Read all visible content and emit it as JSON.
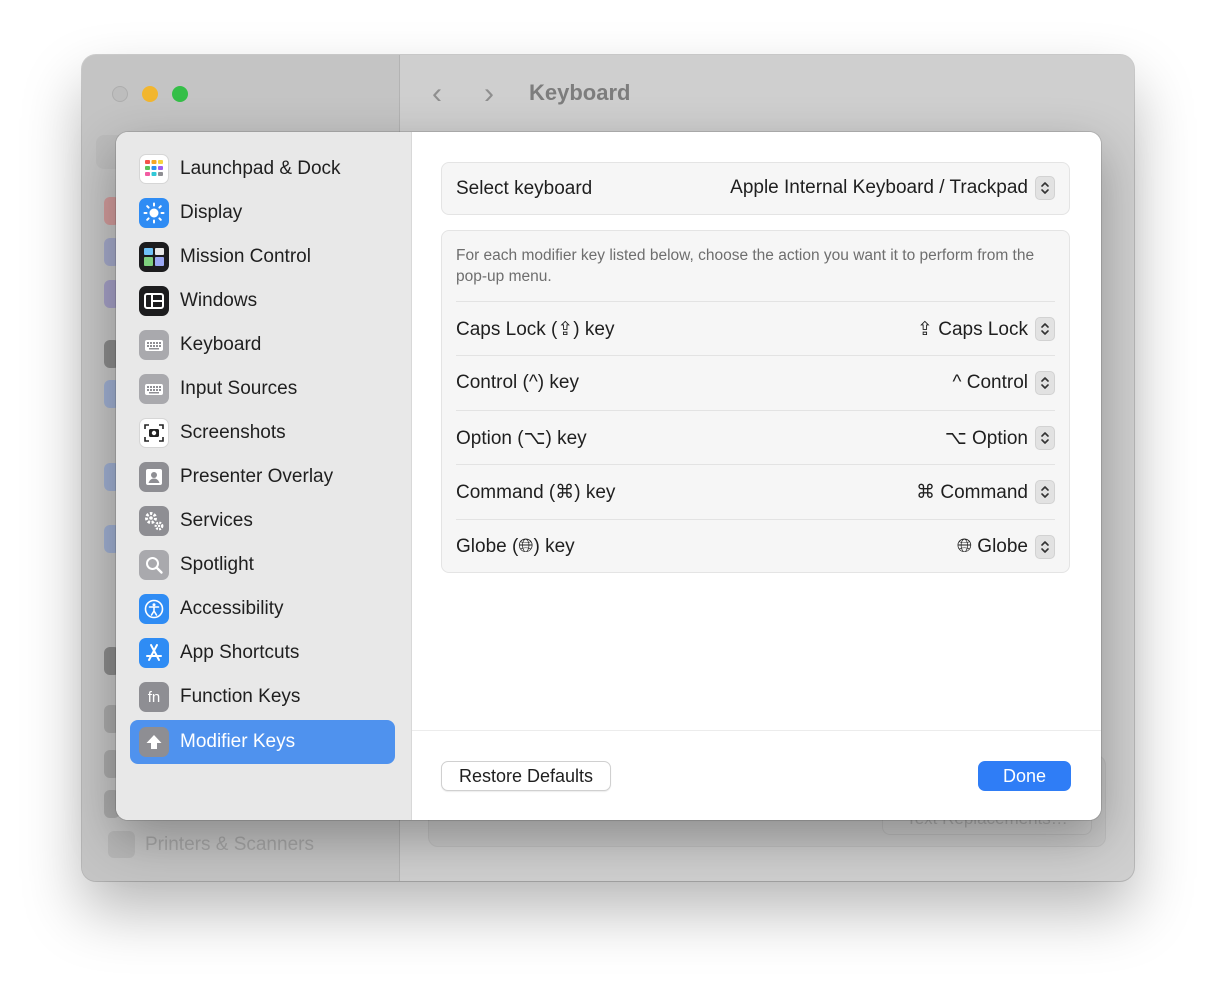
{
  "window": {
    "title": "Keyboard",
    "back": "‹",
    "forward": "›"
  },
  "background_sidebar": {
    "partial_item": "Printers & Scanners"
  },
  "background_button": "Text Replacements…",
  "sidebar": {
    "items": [
      {
        "label": "Launchpad & Dock",
        "icon": "launchpad-dock-icon"
      },
      {
        "label": "Display",
        "icon": "display-icon"
      },
      {
        "label": "Mission Control",
        "icon": "mission-control-icon"
      },
      {
        "label": "Windows",
        "icon": "windows-icon"
      },
      {
        "label": "Keyboard",
        "icon": "keyboard-icon"
      },
      {
        "label": "Input Sources",
        "icon": "input-sources-icon"
      },
      {
        "label": "Screenshots",
        "icon": "screenshots-icon"
      },
      {
        "label": "Presenter Overlay",
        "icon": "presenter-overlay-icon"
      },
      {
        "label": "Services",
        "icon": "services-icon"
      },
      {
        "label": "Spotlight",
        "icon": "spotlight-icon"
      },
      {
        "label": "Accessibility",
        "icon": "accessibility-icon"
      },
      {
        "label": "App Shortcuts",
        "icon": "app-shortcuts-icon"
      },
      {
        "label": "Function Keys",
        "icon": "function-keys-icon"
      },
      {
        "label": "Modifier Keys",
        "icon": "modifier-keys-icon",
        "selected": true
      }
    ]
  },
  "select_keyboard": {
    "label": "Select keyboard",
    "value": "Apple Internal Keyboard / Trackpad"
  },
  "modifiers": {
    "description": "For each modifier key listed below, choose the action you want it to perform from the pop-up menu.",
    "rows": [
      {
        "label": "Caps Lock (⇪) key",
        "value": "⇪ Caps Lock"
      },
      {
        "label": "Control (^) key",
        "value": "^ Control"
      },
      {
        "label": "Option (⌥) key",
        "value": "⌥ Option"
      },
      {
        "label": "Command (⌘) key",
        "value": "⌘ Command"
      },
      {
        "label": "Globe (🌐︎) key",
        "value": "🌐︎ Globe"
      }
    ]
  },
  "buttons": {
    "restore": "Restore Defaults",
    "done": "Done"
  },
  "colors": {
    "accent": "#2f7df6",
    "selection": "#4f92ee"
  }
}
